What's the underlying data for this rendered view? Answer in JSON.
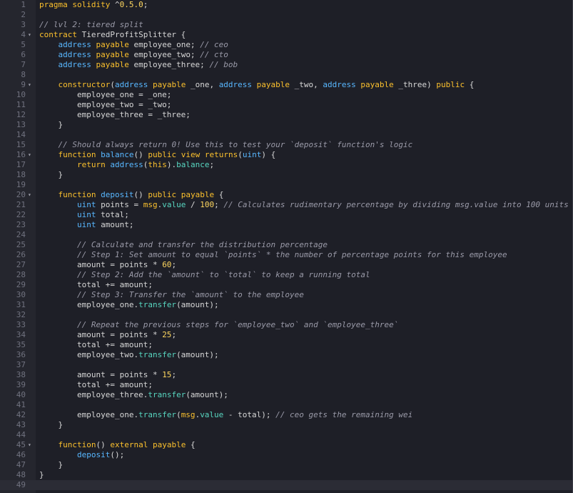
{
  "editor": {
    "colors": {
      "background": "#1e1f27",
      "gutter": "#25262e",
      "keyword": "#fbc02d",
      "type": "#58b7ff",
      "comment": "#9a9aa8",
      "member": "#58d6c0"
    },
    "lines": [
      {
        "n": 1,
        "fold": false,
        "code": "pragma solidity ^0.5.0;"
      },
      {
        "n": 2,
        "fold": false,
        "code": ""
      },
      {
        "n": 3,
        "fold": false,
        "code": "// lvl 2: tiered split"
      },
      {
        "n": 4,
        "fold": true,
        "code": "contract TieredProfitSplitter {"
      },
      {
        "n": 5,
        "fold": false,
        "code": "    address payable employee_one; // ceo"
      },
      {
        "n": 6,
        "fold": false,
        "code": "    address payable employee_two; // cto"
      },
      {
        "n": 7,
        "fold": false,
        "code": "    address payable employee_three; // bob"
      },
      {
        "n": 8,
        "fold": false,
        "code": ""
      },
      {
        "n": 9,
        "fold": true,
        "code": "    constructor(address payable _one, address payable _two, address payable _three) public {"
      },
      {
        "n": 10,
        "fold": false,
        "code": "        employee_one = _one;"
      },
      {
        "n": 11,
        "fold": false,
        "code": "        employee_two = _two;"
      },
      {
        "n": 12,
        "fold": false,
        "code": "        employee_three = _three;"
      },
      {
        "n": 13,
        "fold": false,
        "code": "    }"
      },
      {
        "n": 14,
        "fold": false,
        "code": ""
      },
      {
        "n": 15,
        "fold": false,
        "code": "    // Should always return 0! Use this to test your `deposit` function's logic"
      },
      {
        "n": 16,
        "fold": true,
        "code": "    function balance() public view returns(uint) {"
      },
      {
        "n": 17,
        "fold": false,
        "code": "        return address(this).balance;"
      },
      {
        "n": 18,
        "fold": false,
        "code": "    }"
      },
      {
        "n": 19,
        "fold": false,
        "code": ""
      },
      {
        "n": 20,
        "fold": true,
        "code": "    function deposit() public payable {"
      },
      {
        "n": 21,
        "fold": false,
        "code": "        uint points = msg.value / 100; // Calculates rudimentary percentage by dividing msg.value into 100 units"
      },
      {
        "n": 22,
        "fold": false,
        "code": "        uint total;"
      },
      {
        "n": 23,
        "fold": false,
        "code": "        uint amount;"
      },
      {
        "n": 24,
        "fold": false,
        "code": ""
      },
      {
        "n": 25,
        "fold": false,
        "code": "        // Calculate and transfer the distribution percentage"
      },
      {
        "n": 26,
        "fold": false,
        "code": "        // Step 1: Set amount to equal `points` * the number of percentage points for this employee"
      },
      {
        "n": 27,
        "fold": false,
        "code": "        amount = points * 60;"
      },
      {
        "n": 28,
        "fold": false,
        "code": "        // Step 2: Add the `amount` to `total` to keep a running total"
      },
      {
        "n": 29,
        "fold": false,
        "code": "        total += amount;"
      },
      {
        "n": 30,
        "fold": false,
        "code": "        // Step 3: Transfer the `amount` to the employee"
      },
      {
        "n": 31,
        "fold": false,
        "code": "        employee_one.transfer(amount);"
      },
      {
        "n": 32,
        "fold": false,
        "code": ""
      },
      {
        "n": 33,
        "fold": false,
        "code": "        // Repeat the previous steps for `employee_two` and `employee_three`"
      },
      {
        "n": 34,
        "fold": false,
        "code": "        amount = points * 25;"
      },
      {
        "n": 35,
        "fold": false,
        "code": "        total += amount;"
      },
      {
        "n": 36,
        "fold": false,
        "code": "        employee_two.transfer(amount);"
      },
      {
        "n": 37,
        "fold": false,
        "code": ""
      },
      {
        "n": 38,
        "fold": false,
        "code": "        amount = points * 15;"
      },
      {
        "n": 39,
        "fold": false,
        "code": "        total += amount;"
      },
      {
        "n": 40,
        "fold": false,
        "code": "        employee_three.transfer(amount);"
      },
      {
        "n": 41,
        "fold": false,
        "code": ""
      },
      {
        "n": 42,
        "fold": false,
        "code": "        employee_one.transfer(msg.value - total); // ceo gets the remaining wei"
      },
      {
        "n": 43,
        "fold": false,
        "code": "    }"
      },
      {
        "n": 44,
        "fold": false,
        "code": ""
      },
      {
        "n": 45,
        "fold": true,
        "code": "    function() external payable {"
      },
      {
        "n": 46,
        "fold": false,
        "code": "        deposit();"
      },
      {
        "n": 47,
        "fold": false,
        "code": "    }"
      },
      {
        "n": 48,
        "fold": false,
        "code": "}"
      },
      {
        "n": 49,
        "fold": false,
        "code": ""
      }
    ],
    "current_line": 49,
    "fold_icon": "chevron-down-icon"
  }
}
